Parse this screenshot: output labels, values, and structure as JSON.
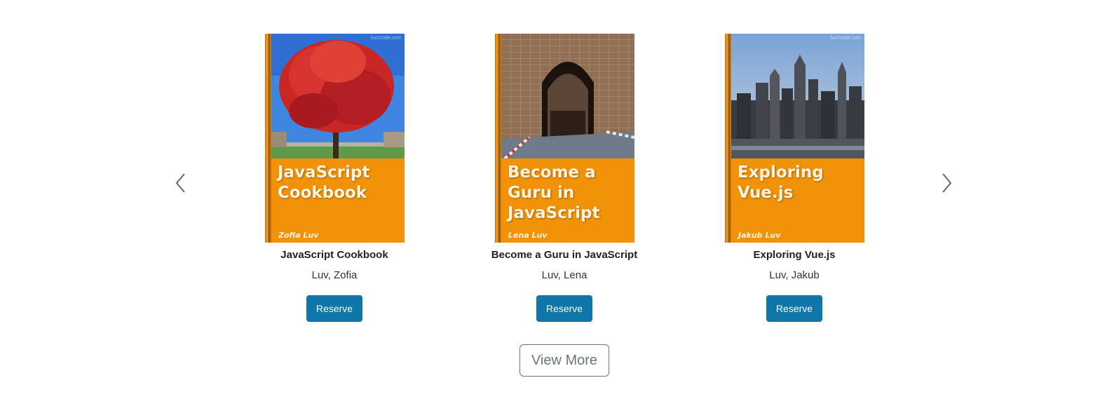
{
  "carousel": {
    "prev_icon": "chevron-left-icon",
    "next_icon": "chevron-right-icon",
    "books": [
      {
        "title": "JavaScript Cookbook",
        "author": "Luv, Zofia",
        "cover_title": "JavaScript Cookbook",
        "cover_author": "Zofia Luv",
        "cover_watermark": "luv2code.com",
        "reserve_label": "Reserve"
      },
      {
        "title": "Become a Guru in JavaScript",
        "author": "Luv, Lena",
        "cover_title": "Become a Guru in JavaScript",
        "cover_author": "Lena Luv",
        "cover_watermark": "",
        "reserve_label": "Reserve"
      },
      {
        "title": "Exploring Vue.js",
        "author": "Luv, Jakub",
        "cover_title": "Exploring Vue.js",
        "cover_author": "Jakub Luv",
        "cover_watermark": "luv2code.com",
        "reserve_label": "Reserve"
      }
    ],
    "view_more_label": "View More"
  },
  "colors": {
    "cover_orange": "#f29208",
    "button_blue": "#0e76a8",
    "outline_gray": "#6c757d"
  }
}
